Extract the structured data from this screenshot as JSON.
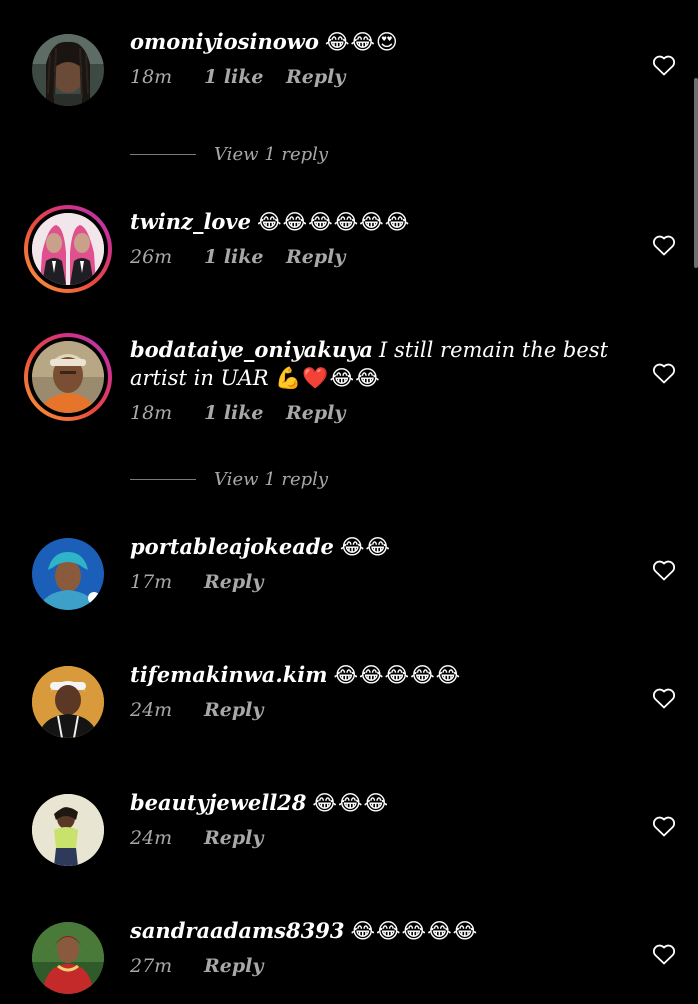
{
  "colors": {
    "background": "#000000",
    "text_primary": "#ffffff",
    "text_secondary": "#a8a8a8",
    "story_ring": [
      "#f9a13a",
      "#e9483c",
      "#d13188",
      "#a43ec4"
    ]
  },
  "comments": [
    {
      "username": "omoniyiosinowo",
      "text": "",
      "emoji": "😂😂😍",
      "time": "18m",
      "likes": "1 like",
      "reply_label": "Reply",
      "view_replies": "View 1 reply",
      "icon": "heart-outline-icon"
    },
    {
      "username": "twinz_love",
      "text": "",
      "emoji": "😂😂😂😂😂😂",
      "time": "26m",
      "likes": "1 like",
      "reply_label": "Reply",
      "icon": "heart-outline-icon"
    },
    {
      "username": "bodataiye_oniyakuya",
      "text": "I still remain the best artist in UAR",
      "emoji": "💪❤️😂😂",
      "time": "18m",
      "likes": "1 like",
      "reply_label": "Reply",
      "view_replies": "View 1 reply",
      "icon": "heart-outline-icon"
    },
    {
      "username": "portableajokeade",
      "text": "",
      "emoji": "😂😂",
      "time": "17m",
      "reply_label": "Reply",
      "icon": "heart-outline-icon"
    },
    {
      "username": "tifemakinwa.kim",
      "text": "",
      "emoji": "😂😂😂😂😂",
      "time": "24m",
      "reply_label": "Reply",
      "icon": "heart-outline-icon"
    },
    {
      "username": "beautyjewell28",
      "text": "",
      "emoji": "😂😂😂",
      "time": "24m",
      "reply_label": "Reply",
      "icon": "heart-outline-icon"
    },
    {
      "username": "sandraadams8393",
      "text": "",
      "emoji": "😂😂😂😂😂",
      "time": "27m",
      "reply_label": "Reply",
      "icon": "heart-outline-icon"
    }
  ]
}
